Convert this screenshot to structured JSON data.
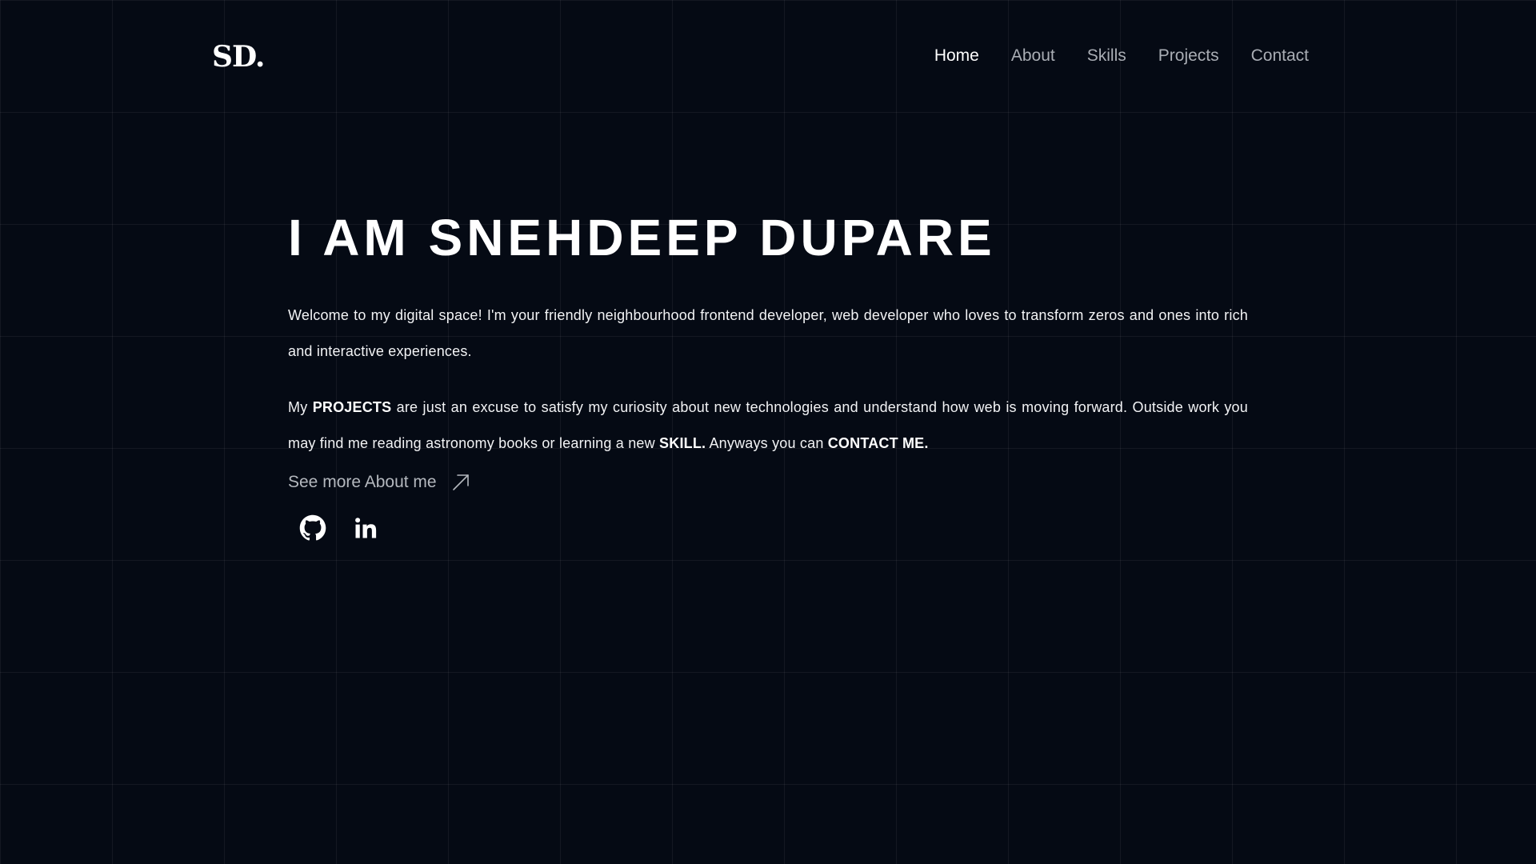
{
  "header": {
    "logo": "SD.",
    "nav": [
      {
        "label": "Home",
        "active": true
      },
      {
        "label": "About",
        "active": false
      },
      {
        "label": "Skills",
        "active": false
      },
      {
        "label": "Projects",
        "active": false
      },
      {
        "label": "Contact",
        "active": false
      }
    ]
  },
  "hero": {
    "title": "I AM SNEHDEEP DUPARE",
    "intro": "Welcome to my digital space! I'm your friendly neighbourhood frontend developer, web developer who loves to transform zeros and ones into rich and interactive experiences.",
    "para2": {
      "t1": "My ",
      "b1": "PROJECTS",
      "t2": " are just an excuse to satisfy my curiosity about new technologies and understand how web is moving forward. Outside work you may find me reading astronomy books or learning a new ",
      "b2": "SKILL.",
      "t3": " Anyways you can ",
      "b3": "CONTACT ME."
    },
    "see_more": "See more About me",
    "see_more_icon": "arrow-up-right-icon",
    "socials": [
      {
        "icon": "github-icon"
      },
      {
        "icon": "linkedin-icon"
      }
    ]
  },
  "colors": {
    "background": "#050a14",
    "text": "#ffffff",
    "muted": "#a9adb4"
  }
}
